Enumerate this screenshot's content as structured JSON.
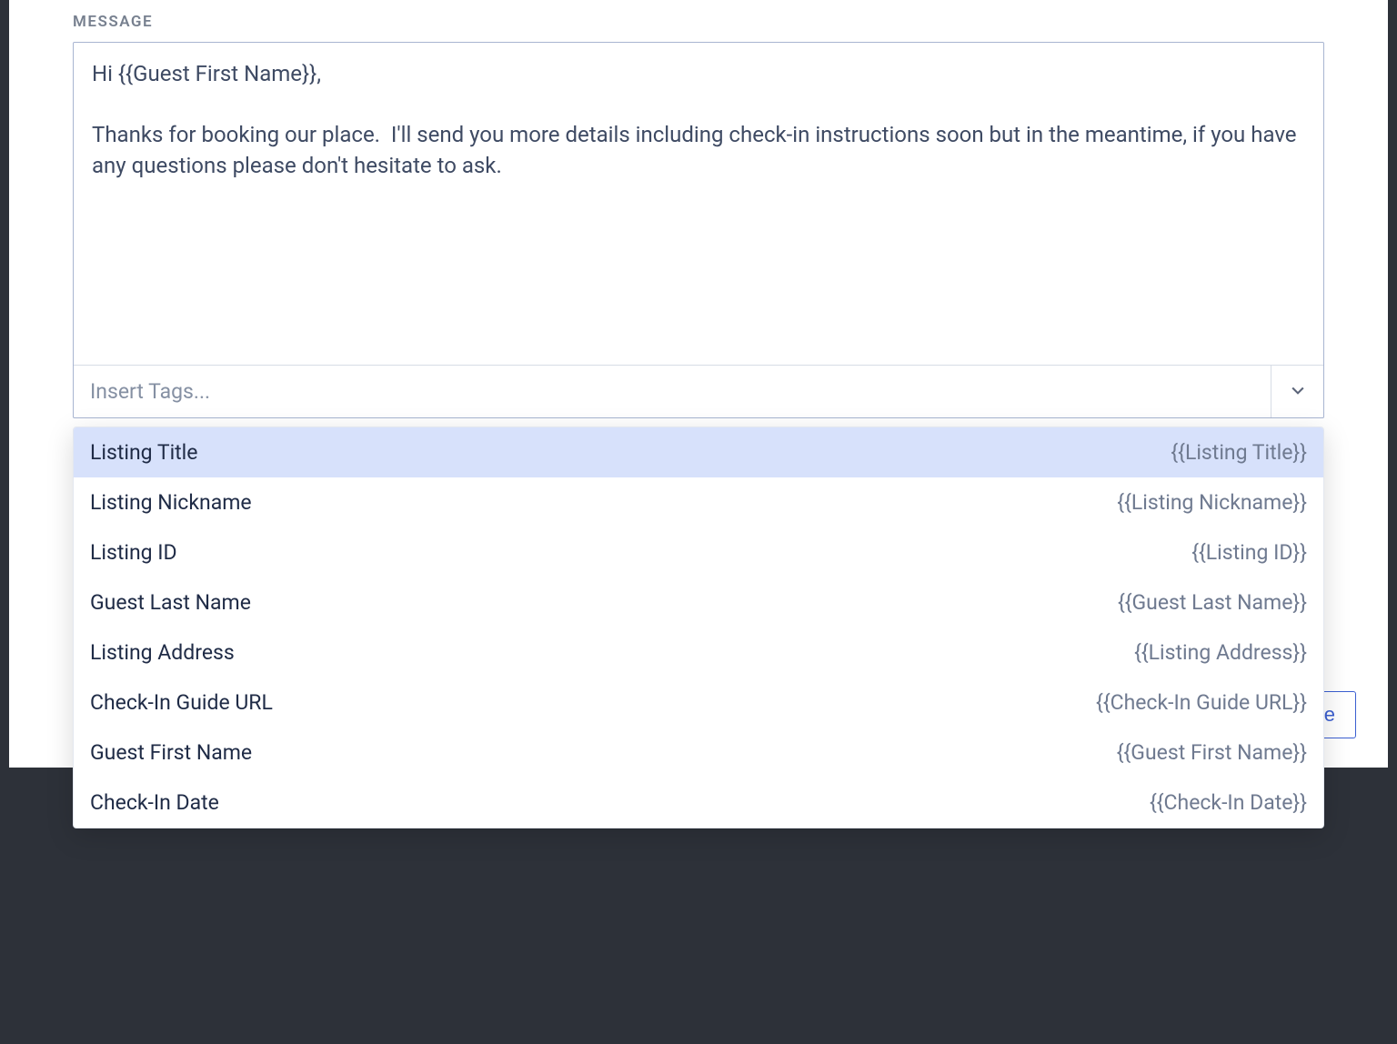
{
  "section_label": "MESSAGE",
  "message_value": "Hi {{Guest First Name}},\n\nThanks for booking our place.  I'll send you more details including check-in instructions soon but in the meantime, if you have any questions please don't hesitate to ask.",
  "insert_tags_placeholder": "Insert Tags...",
  "tags": [
    {
      "label": "Listing Title",
      "token": "{{Listing Title}}",
      "highlighted": true
    },
    {
      "label": "Listing Nickname",
      "token": "{{Listing Nickname}}",
      "highlighted": false
    },
    {
      "label": "Listing ID",
      "token": "{{Listing ID}}",
      "highlighted": false
    },
    {
      "label": "Guest Last Name",
      "token": "{{Guest Last Name}}",
      "highlighted": false
    },
    {
      "label": "Listing Address",
      "token": "{{Listing Address}}",
      "highlighted": false
    },
    {
      "label": "Check-In Guide URL",
      "token": "{{Check-In Guide URL}}",
      "highlighted": false
    },
    {
      "label": "Guest First Name",
      "token": "{{Guest First Name}}",
      "highlighted": false
    },
    {
      "label": "Check-In Date",
      "token": "{{Check-In Date}}",
      "highlighted": false
    }
  ],
  "peek_button_fragment": "e"
}
